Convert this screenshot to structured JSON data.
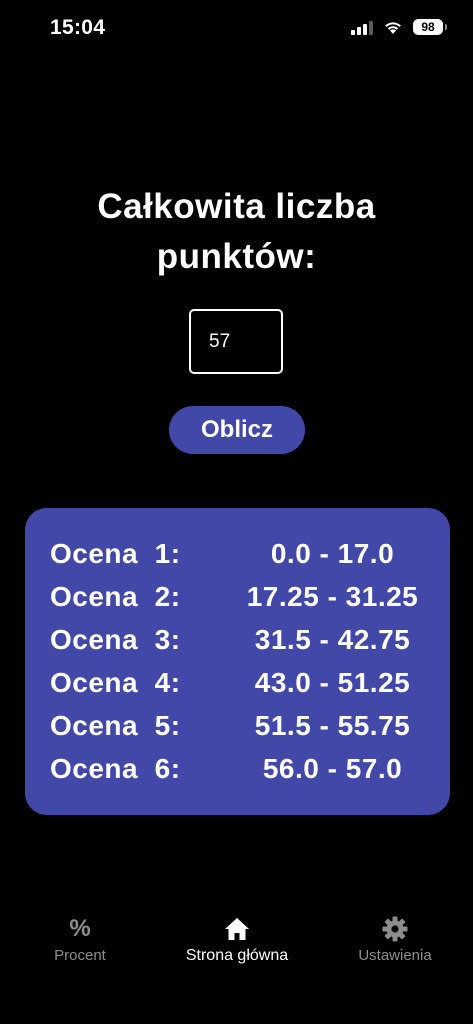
{
  "status_bar": {
    "time": "15:04",
    "battery": "98"
  },
  "title": "Całkowita liczba punktów:",
  "input": {
    "value": "57"
  },
  "calculate_button": {
    "label": "Oblicz"
  },
  "results": [
    {
      "label": "Ocena  1:",
      "range": "0.0 - 17.0"
    },
    {
      "label": "Ocena  2:",
      "range": "17.25 - 31.25"
    },
    {
      "label": "Ocena  3:",
      "range": "31.5 - 42.75"
    },
    {
      "label": "Ocena  4:",
      "range": "43.0 - 51.25"
    },
    {
      "label": "Ocena  5:",
      "range": "51.5 - 55.75"
    },
    {
      "label": "Ocena  6:",
      "range": "56.0 - 57.0"
    }
  ],
  "tab_bar": {
    "procent": {
      "label": "Procent",
      "icon": "percent-icon"
    },
    "home": {
      "label": "Strona główna",
      "icon": "home-icon"
    },
    "settings": {
      "label": "Ustawienia",
      "icon": "gear-icon"
    }
  },
  "colors": {
    "accent": "#4248a8",
    "background": "#000000",
    "inactive_tab": "#8d8d8d"
  }
}
